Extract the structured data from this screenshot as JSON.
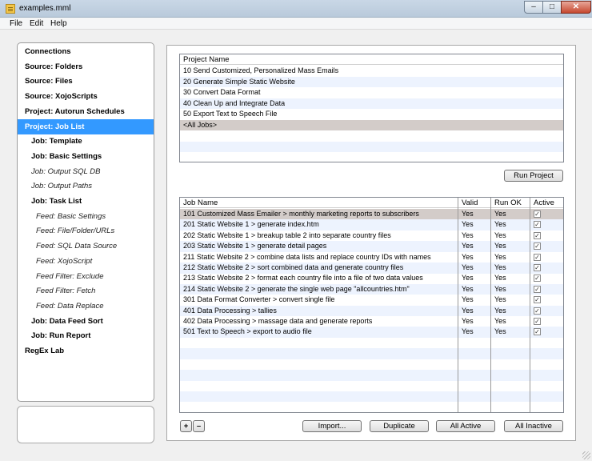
{
  "window": {
    "title": "examples.mml",
    "controls": {
      "minimize": "–",
      "maximize": "□",
      "close": "✕"
    }
  },
  "menu": [
    "File",
    "Edit",
    "Help"
  ],
  "sidebar": {
    "selected_index": 5,
    "items": [
      {
        "label": "Connections",
        "style": "section"
      },
      {
        "label": "Source: Folders",
        "style": "section"
      },
      {
        "label": "Source: Files",
        "style": "section"
      },
      {
        "label": "Source: XojoScripts",
        "style": "section"
      },
      {
        "label": "Project: Autorun Schedules",
        "style": "section"
      },
      {
        "label": "Project: Job List",
        "style": "section"
      },
      {
        "label": "Job: Template",
        "style": "job"
      },
      {
        "label": "Job: Basic Settings",
        "style": "job"
      },
      {
        "label": "Job: Output SQL DB",
        "style": "job-italic"
      },
      {
        "label": "Job: Output Paths",
        "style": "job-italic"
      },
      {
        "label": "Job: Task List",
        "style": "job"
      },
      {
        "label": "Feed: Basic Settings",
        "style": "feed-italic"
      },
      {
        "label": "Feed: File/Folder/URLs",
        "style": "feed-italic"
      },
      {
        "label": "Feed: SQL Data Source",
        "style": "feed-italic"
      },
      {
        "label": "Feed: XojoScript",
        "style": "feed-italic"
      },
      {
        "label": "Feed Filter: Exclude",
        "style": "feed-italic"
      },
      {
        "label": "Feed Filter: Fetch",
        "style": "feed-italic"
      },
      {
        "label": "Feed: Data Replace",
        "style": "feed-italic"
      },
      {
        "label": "Job: Data Feed Sort",
        "style": "job"
      },
      {
        "label": "Job: Run Report",
        "style": "job"
      },
      {
        "label": "RegEx Lab",
        "style": "section"
      }
    ]
  },
  "projects": {
    "header": "Project Name",
    "selected_index": 5,
    "rows": [
      "10 Send Customized, Personalized Mass Emails",
      "20 Generate Simple Static Website",
      "30 Convert Data Format",
      "40 Clean Up and Integrate Data",
      "50 Export Text to Speech File",
      "<All Jobs>"
    ]
  },
  "run_project_button": "Run Project",
  "jobs": {
    "headers": {
      "name": "Job Name",
      "valid": "Valid",
      "run_ok": "Run OK",
      "active": "Active"
    },
    "selected_index": 0,
    "check_mark": "✓",
    "rows": [
      {
        "name": "101 Customized Mass Emailer > monthly marketing reports to subscribers",
        "valid": "Yes",
        "run_ok": "Yes",
        "active": true
      },
      {
        "name": "201 Static Website 1 > generate index.htm",
        "valid": "Yes",
        "run_ok": "Yes",
        "active": true
      },
      {
        "name": "202 Static Website 1 > breakup table 2 into separate country files",
        "valid": "Yes",
        "run_ok": "Yes",
        "active": true
      },
      {
        "name": "203 Static Website 1 > generate detail pages",
        "valid": "Yes",
        "run_ok": "Yes",
        "active": true
      },
      {
        "name": "211 Static Website 2 > combine data lists and replace country IDs with names",
        "valid": "Yes",
        "run_ok": "Yes",
        "active": true
      },
      {
        "name": "212 Static Website 2 > sort combined data and generate country files",
        "valid": "Yes",
        "run_ok": "Yes",
        "active": true
      },
      {
        "name": "213 Static Website 2 > format each country file into a file of two data values",
        "valid": "Yes",
        "run_ok": "Yes",
        "active": true
      },
      {
        "name": "214 Static Website 2 > generate the single web page \"allcountries.htm\"",
        "valid": "Yes",
        "run_ok": "Yes",
        "active": true
      },
      {
        "name": "301 Data Format Converter > convert single file",
        "valid": "Yes",
        "run_ok": "Yes",
        "active": true
      },
      {
        "name": "401 Data Processing > tallies",
        "valid": "Yes",
        "run_ok": "Yes",
        "active": true
      },
      {
        "name": "402 Data Processing > massage data and generate reports",
        "valid": "Yes",
        "run_ok": "Yes",
        "active": true
      },
      {
        "name": "501 Text to Speech > export to audio file",
        "valid": "Yes",
        "run_ok": "Yes",
        "active": true
      }
    ]
  },
  "bottom_buttons": {
    "add": "+",
    "remove": "–",
    "import": "Import...",
    "duplicate": "Duplicate",
    "all_active": "All Active",
    "all_inactive": "All Inactive"
  }
}
